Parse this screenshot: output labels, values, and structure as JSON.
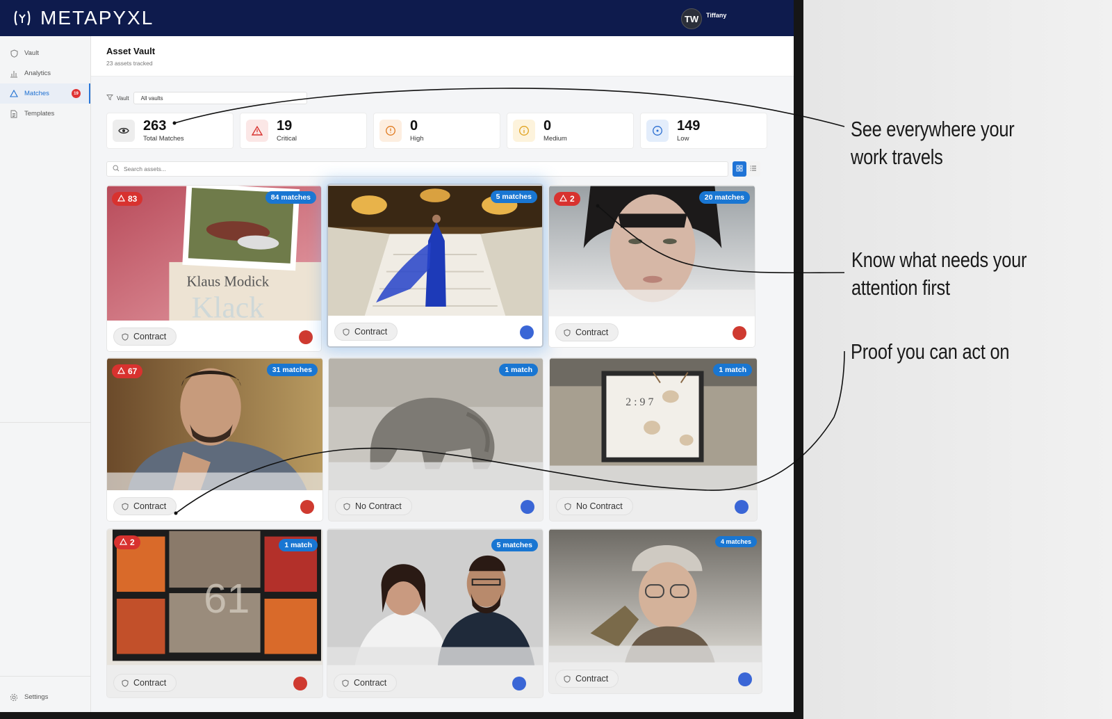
{
  "app": {
    "brand": "METAPYXL",
    "user": {
      "initials": "TW",
      "name": "Tiffany"
    }
  },
  "sidebar": {
    "items": [
      {
        "label": "Vault",
        "icon": "shield-icon"
      },
      {
        "label": "Analytics",
        "icon": "bar-chart-icon"
      },
      {
        "label": "Matches",
        "icon": "alert-triangle-icon",
        "badge": "19",
        "active": true
      },
      {
        "label": "Templates",
        "icon": "document-icon"
      }
    ],
    "settings_label": "Settings"
  },
  "page": {
    "title": "Asset Vault",
    "subtitle": "23 assets tracked"
  },
  "filter": {
    "label": "Vault",
    "value": "All vaults"
  },
  "stats": [
    {
      "value": "263",
      "label": "Total Matches",
      "icon": "eye-icon",
      "color": "#555555"
    },
    {
      "value": "19",
      "label": "Critical",
      "icon": "alert-triangle-icon",
      "color": "#d8322f"
    },
    {
      "value": "0",
      "label": "High",
      "icon": "alert-circle-icon",
      "color": "#e07a1f"
    },
    {
      "value": "0",
      "label": "Medium",
      "icon": "info-circle-icon",
      "color": "#e0a21f"
    },
    {
      "value": "149",
      "label": "Low",
      "icon": "target-icon",
      "color": "#2c6fd1"
    }
  ],
  "search": {
    "placeholder": "Search assets..."
  },
  "cards": [
    {
      "alert": "83",
      "matches": "84 matches",
      "contract": "Contract",
      "status_color": "#cf3a30",
      "image": "book-cover-klaus-modick"
    },
    {
      "alert": "",
      "matches": "5 matches",
      "contract": "Contract",
      "status_color": "#3a66d6",
      "image": "woman-blue-gown-staircase"
    },
    {
      "alert": "2",
      "matches": "20 matches",
      "contract": "Contract",
      "status_color": "#cf3a30",
      "image": "woman-portrait-bangs"
    },
    {
      "alert": "67",
      "matches": "31 matches",
      "contract": "Contract",
      "status_color": "#cf3a30",
      "image": "man-portrait-tshirt"
    },
    {
      "alert": "",
      "matches": "1 match",
      "contract": "No Contract",
      "status_color": "#3a66d6",
      "image": "elephant-sepia"
    },
    {
      "alert": "",
      "matches": "1 match",
      "contract": "No Contract",
      "status_color": "#3a66d6",
      "image": "skulls-frame-collage"
    },
    {
      "alert": "2",
      "matches": "1 match",
      "contract": "Contract",
      "status_color": "#cf3a30",
      "image": "abstract-grid-painting"
    },
    {
      "alert": "",
      "matches": "5 matches",
      "contract": "Contract",
      "status_color": "#3a66d6",
      "image": "couple-portrait"
    },
    {
      "alert": "",
      "matches": "4 matches",
      "contract": "Contract",
      "status_color": "#3a66d6",
      "image": "woman-beanie-glasses"
    }
  ],
  "annotations": [
    {
      "line1": "See everywhere your",
      "line2": "work travels"
    },
    {
      "line1": "Know what needs your",
      "line2": "attention first"
    },
    {
      "line1": "Proof you can act on",
      "line2": ""
    }
  ]
}
